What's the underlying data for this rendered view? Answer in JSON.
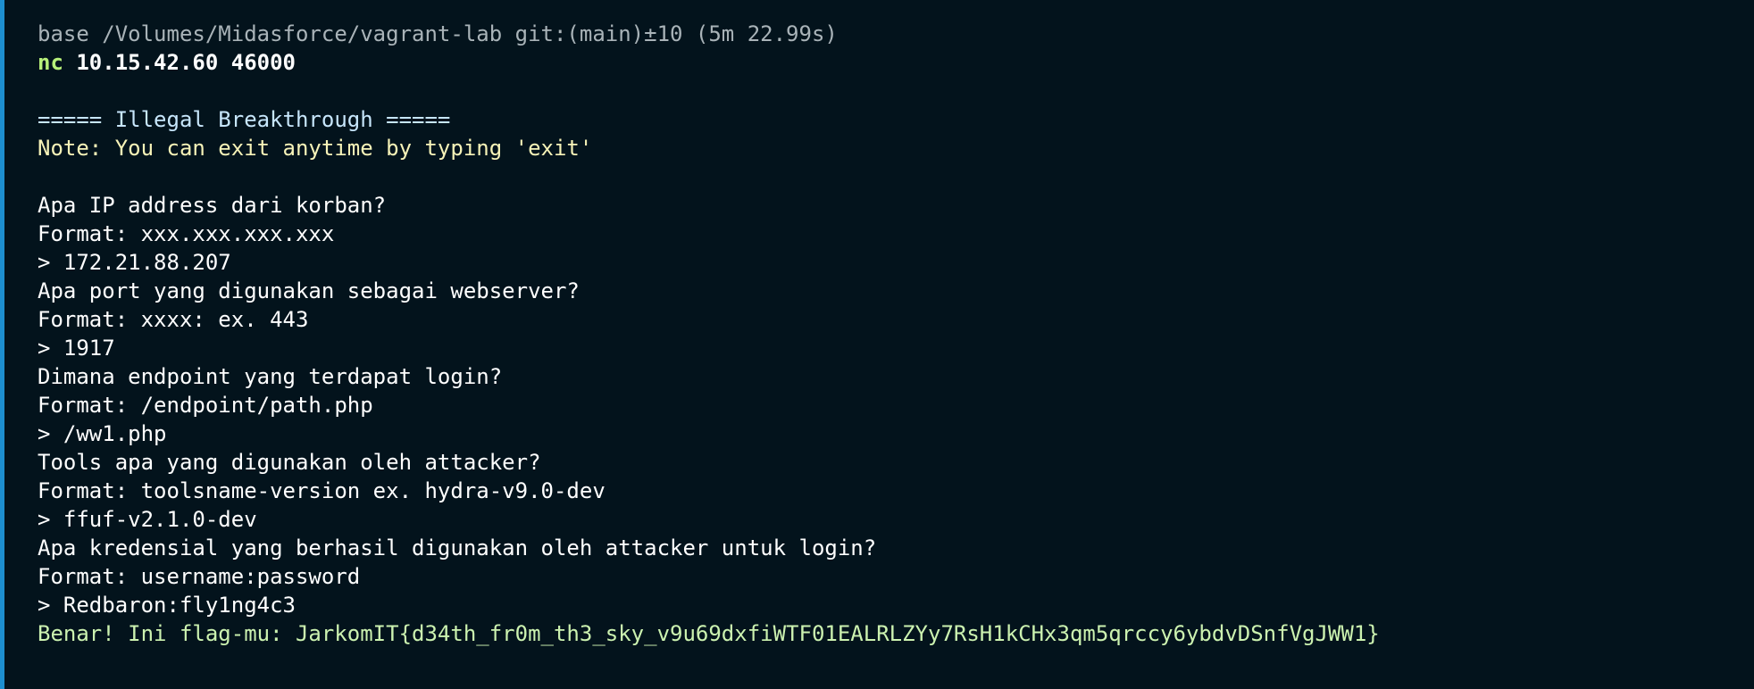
{
  "prompt": {
    "header": "base /Volumes/Midasforce/vagrant-lab git:(main)±10 (5m 22.99s)",
    "command_keyword": "nc",
    "command_args": "10.15.42.60 46000"
  },
  "banner": "===== Illegal Breakthrough =====",
  "note": "Note: You can exit anytime by typing 'exit'",
  "qa": [
    {
      "question": "Apa IP address dari korban?",
      "format": "Format: xxx.xxx.xxx.xxx",
      "answer": "> 172.21.88.207"
    },
    {
      "question": "Apa port yang digunakan sebagai webserver?",
      "format": "Format: xxxx: ex. 443",
      "answer": "> 1917"
    },
    {
      "question": "Dimana endpoint yang terdapat login?",
      "format": "Format: /endpoint/path.php",
      "answer": "> /ww1.php"
    },
    {
      "question": "Tools apa yang digunakan oleh attacker?",
      "format": "Format: toolsname-version ex. hydra-v9.0-dev",
      "answer": "> ffuf-v2.1.0-dev"
    },
    {
      "question": "Apa kredensial yang berhasil digunakan oleh attacker untuk login?",
      "format": "Format: username:password",
      "answer": "> Redbaron:fly1ng4c3"
    }
  ],
  "result": "Benar! Ini flag-mu: JarkomIT{d34th_fr0m_th3_sky_v9u69dxfiWTF01EALRLZYy7RsH1kCHx3qm5qrccy6ybdvDSnfVgJWW1}",
  "colors": {
    "background": "#03131c",
    "accent_bar": "#1d8fd0",
    "command_keyword": "#b7f07a",
    "banner": "#c7e6fb",
    "note": "#f7f3b8",
    "flag": "#ccf2b0"
  }
}
